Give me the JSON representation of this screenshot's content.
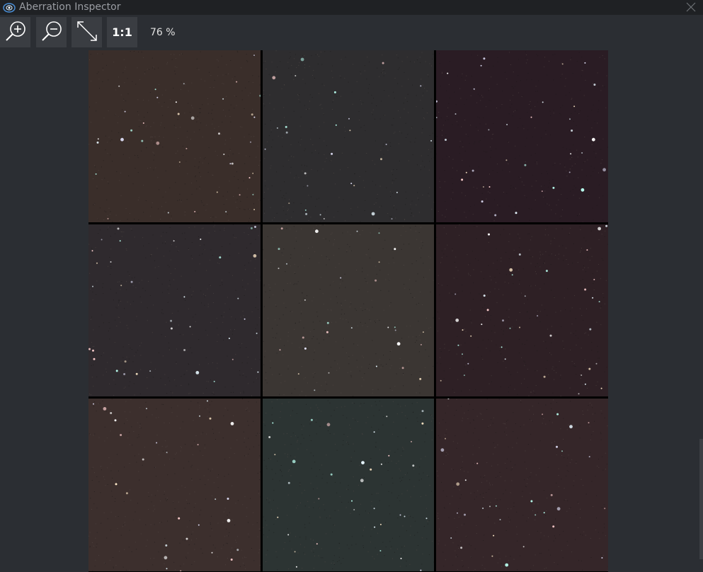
{
  "window": {
    "title": "Aberration Inspector",
    "app_icon": "galaxy-icon",
    "close_icon": "close-icon"
  },
  "toolbar": {
    "zoom_in_icon": "zoom-in-icon",
    "zoom_out_icon": "zoom-out-icon",
    "fit_icon": "fit-to-window-icon",
    "one_to_one_label": "1:1",
    "zoom_level": "76 %"
  },
  "mosaic": {
    "rows": 3,
    "cols": 3,
    "separator_color": "#000000",
    "tiles": [
      {
        "position": "top-left",
        "color": "#3a2e2a"
      },
      {
        "position": "top-center",
        "color": "#2e2d2f"
      },
      {
        "position": "top-right",
        "color": "#2a1c24"
      },
      {
        "position": "middle-left",
        "color": "#2f2a2e"
      },
      {
        "position": "middle-center",
        "color": "#3b3633"
      },
      {
        "position": "middle-right",
        "color": "#2e2025"
      },
      {
        "position": "bottom-left",
        "color": "#3c2f2d"
      },
      {
        "position": "bottom-center",
        "color": "#2c3433"
      },
      {
        "position": "bottom-right",
        "color": "#352629"
      }
    ]
  }
}
